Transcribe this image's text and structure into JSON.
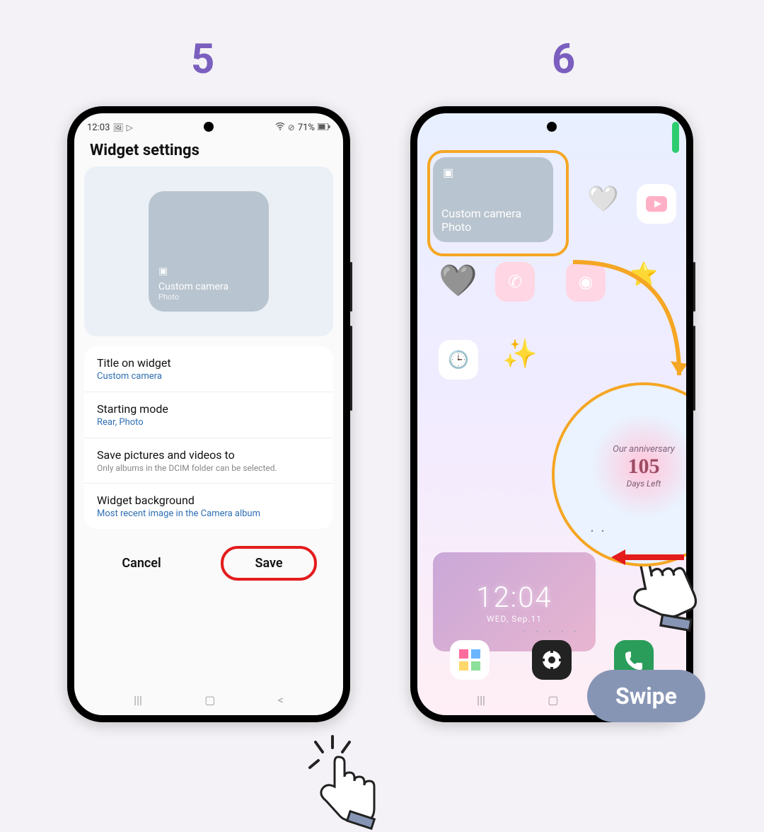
{
  "steps": {
    "five": "5",
    "six": "6"
  },
  "phone1": {
    "statusbar": {
      "time": "12:03",
      "battery": "71%"
    },
    "header": "Widget settings",
    "preview": {
      "title": "Custom camera",
      "subtitle": "Photo"
    },
    "rows": {
      "title_label": "Title on widget",
      "title_value": "Custom camera",
      "mode_label": "Starting mode",
      "mode_value": "Rear, Photo",
      "save_label": "Save pictures and videos to",
      "save_desc": "Only albums in the DCIM folder can be selected.",
      "bg_label": "Widget background",
      "bg_value": "Most recent image in the Camera album"
    },
    "buttons": {
      "cancel": "Cancel",
      "save": "Save"
    }
  },
  "phone2": {
    "widget": {
      "title": "Custom camera",
      "subtitle": "Photo"
    },
    "callout": {
      "title": "Our anniversary",
      "number": "105",
      "sub": "Days Left"
    },
    "clock": {
      "time": "12:04",
      "date": "WED, Sep.11"
    }
  },
  "swipe_label": "Swipe"
}
